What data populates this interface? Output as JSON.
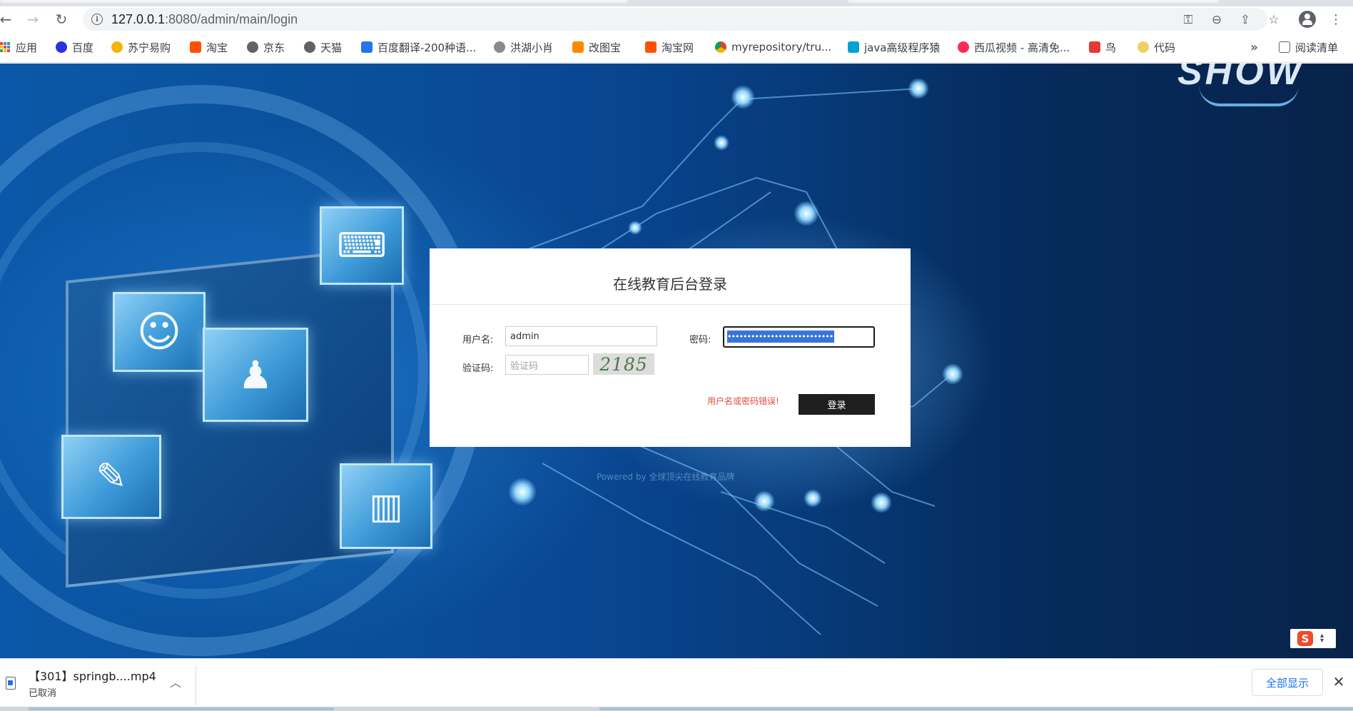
{
  "browser": {
    "url_host": "127.0.0.1",
    "url_path": ":8080/admin/main/login"
  },
  "bookmarks": [
    {
      "label": "应用",
      "icon": "apps-grid-icon",
      "color": "#4285f4"
    },
    {
      "label": "百度",
      "icon": "baidu-icon",
      "color": "#2932e1"
    },
    {
      "label": "苏宁易购",
      "icon": "suning-icon",
      "color": "#f6b400"
    },
    {
      "label": "淘宝",
      "icon": "taobao-icon",
      "color": "#ff5000"
    },
    {
      "label": "京东",
      "icon": "globe-icon",
      "color": "#5f6368"
    },
    {
      "label": "天猫",
      "icon": "globe-icon",
      "color": "#5f6368"
    },
    {
      "label": "百度翻译-200种语...",
      "icon": "translate-icon",
      "color": "#2575e8"
    },
    {
      "label": "洪湖小肖",
      "icon": "bird-icon",
      "color": "#6d6d6d"
    },
    {
      "label": "改图宝",
      "icon": "gaitubao-icon",
      "color": "#ff8a00"
    },
    {
      "label": "淘宝网",
      "icon": "taobao-icon",
      "color": "#ff5000"
    },
    {
      "label": "myrepository/tru...",
      "icon": "chrome-icon",
      "color": "#db4437"
    },
    {
      "label": "java高级程序猿",
      "icon": "bilibili-icon",
      "color": "#00a1d6"
    },
    {
      "label": "西瓜视频 - 高清免...",
      "icon": "xigua-icon",
      "color": "#fe2c55"
    },
    {
      "label": "鸟",
      "icon": "bird-icon",
      "color": "#e53935"
    },
    {
      "label": "代码",
      "icon": "code-icon",
      "color": "#f0d060"
    }
  ],
  "bookmarks_overflow": "»",
  "reading_list": "阅读清单",
  "login": {
    "title": "在线教育后台登录",
    "username_label": "用户名:",
    "username_value": "admin",
    "password_label": "密码:",
    "password_mask": "••••••••••••••••••••••••••••••••••••",
    "captcha_label": "验证码:",
    "captcha_placeholder": "验证码",
    "captcha_code": "2185",
    "error_text": "用户名或密码错误!",
    "submit_label": "登录"
  },
  "footer": {
    "powered": "Powered by 全球顶尖在线教育品牌"
  },
  "logo": {
    "text": "SHOW"
  },
  "download": {
    "file_name": "【301】springb....mp4",
    "status": "已取消",
    "show_all": "全部显示"
  },
  "colors": {
    "accent_blue": "#1a73e8",
    "error_red": "#e24b3a",
    "login_button": "#1f1f1f",
    "selection": "#3875d7"
  }
}
